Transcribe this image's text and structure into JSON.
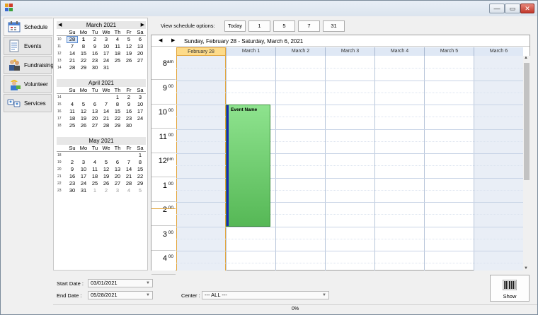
{
  "window": {
    "controls": {
      "minimize": "—",
      "maximize": "▭",
      "close": "✕"
    }
  },
  "nav": {
    "items": [
      {
        "label": "Schedule",
        "icon": "calendar-icon",
        "active": true
      },
      {
        "label": "Events",
        "icon": "document-icon",
        "active": false
      },
      {
        "label": "Fundraising",
        "icon": "users-icon",
        "active": false
      },
      {
        "label": "Volunteer",
        "icon": "worker-icon",
        "active": false
      },
      {
        "label": "Services",
        "icon": "services-icon",
        "active": false
      }
    ]
  },
  "mini_calendars": [
    {
      "title": "March  2021",
      "dow": [
        "Su",
        "Mo",
        "Tu",
        "We",
        "Th",
        "Fr",
        "Sa"
      ],
      "rows": [
        {
          "wk": "10",
          "days": [
            "28",
            "1",
            "2",
            "3",
            "4",
            "5",
            "6"
          ]
        },
        {
          "wk": "11",
          "days": [
            "7",
            "8",
            "9",
            "10",
            "11",
            "12",
            "13"
          ]
        },
        {
          "wk": "12",
          "days": [
            "14",
            "15",
            "16",
            "17",
            "18",
            "19",
            "20"
          ]
        },
        {
          "wk": "13",
          "days": [
            "21",
            "22",
            "23",
            "24",
            "25",
            "26",
            "27"
          ]
        },
        {
          "wk": "14",
          "days": [
            "28",
            "29",
            "30",
            "31",
            "",
            "",
            ""
          ]
        }
      ]
    },
    {
      "title": "April  2021",
      "dow": [
        "Su",
        "Mo",
        "Tu",
        "We",
        "Th",
        "Fr",
        "Sa"
      ],
      "rows": [
        {
          "wk": "14",
          "days": [
            "",
            "",
            "",
            "",
            "1",
            "2",
            "3"
          ]
        },
        {
          "wk": "15",
          "days": [
            "4",
            "5",
            "6",
            "7",
            "8",
            "9",
            "10"
          ]
        },
        {
          "wk": "16",
          "days": [
            "11",
            "12",
            "13",
            "14",
            "15",
            "16",
            "17"
          ]
        },
        {
          "wk": "17",
          "days": [
            "18",
            "19",
            "20",
            "21",
            "22",
            "23",
            "24"
          ]
        },
        {
          "wk": "18",
          "days": [
            "25",
            "26",
            "27",
            "28",
            "29",
            "30",
            ""
          ]
        }
      ]
    },
    {
      "title": "May  2021",
      "dow": [
        "Su",
        "Mo",
        "Tu",
        "We",
        "Th",
        "Fr",
        "Sa"
      ],
      "rows": [
        {
          "wk": "18",
          "days": [
            "",
            "",
            "",
            "",
            "",
            "",
            "1"
          ]
        },
        {
          "wk": "19",
          "days": [
            "2",
            "3",
            "4",
            "5",
            "6",
            "7",
            "8"
          ]
        },
        {
          "wk": "20",
          "days": [
            "9",
            "10",
            "11",
            "12",
            "13",
            "14",
            "15"
          ]
        },
        {
          "wk": "21",
          "days": [
            "16",
            "17",
            "18",
            "19",
            "20",
            "21",
            "22"
          ]
        },
        {
          "wk": "22",
          "days": [
            "23",
            "24",
            "25",
            "26",
            "27",
            "28",
            "29"
          ]
        },
        {
          "wk": "23",
          "days": [
            "30",
            "31",
            "1",
            "2",
            "3",
            "4",
            "5"
          ]
        }
      ]
    }
  ],
  "schedule_options": {
    "label": "View schedule options:",
    "buttons": [
      "Today",
      "1",
      "5",
      "7",
      "31"
    ]
  },
  "schedule": {
    "range": "Sunday, February 28 - Saturday, March 6, 2021",
    "days": [
      "February 28",
      "March 1",
      "March 2",
      "March 3",
      "March 4",
      "March 5",
      "March 6"
    ],
    "hours": [
      {
        "h": "8",
        "ap": "am"
      },
      {
        "h": "9",
        "ap": "00"
      },
      {
        "h": "10",
        "ap": "00"
      },
      {
        "h": "11",
        "ap": "00"
      },
      {
        "h": "12",
        "ap": "pm"
      },
      {
        "h": "1",
        "ap": "00"
      },
      {
        "h": "2",
        "ap": "00"
      },
      {
        "h": "3",
        "ap": "00"
      },
      {
        "h": "4",
        "ap": "00"
      }
    ],
    "event": {
      "title": "Event Name",
      "day": "March 1",
      "start": "10:00",
      "end": "3:00"
    }
  },
  "filters": {
    "start_label": "Start Date :",
    "start_value": "03/01/2021",
    "end_label": "End Date :",
    "end_value": "05/28/2021",
    "center_label": "Center :",
    "center_value": "--- ALL ---"
  },
  "show_button": {
    "label": "Show",
    "icon": "barcode-icon"
  },
  "status": {
    "progress": "0%"
  }
}
